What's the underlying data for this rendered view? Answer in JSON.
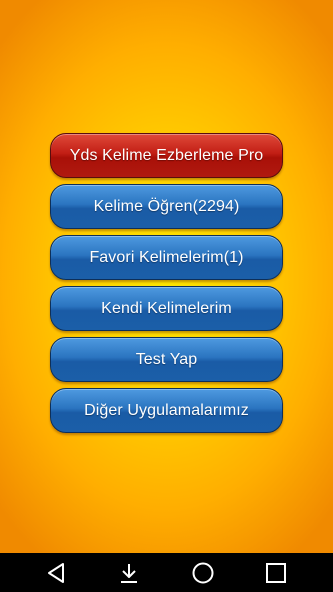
{
  "menu": {
    "items": [
      {
        "label": "Yds Kelime Ezberleme Pro",
        "style": "pro"
      },
      {
        "label": "Kelime Öğren(2294)",
        "style": "normal"
      },
      {
        "label": "Favori Kelimelerim(1)",
        "style": "normal"
      },
      {
        "label": "Kendi Kelimelerim",
        "style": "normal"
      },
      {
        "label": "Test Yap",
        "style": "normal"
      },
      {
        "label": "Diğer Uygulamalarımız",
        "style": "normal"
      }
    ]
  },
  "navbar": {
    "icons": [
      "back-icon",
      "download-icon",
      "home-icon",
      "recents-icon"
    ]
  },
  "colors": {
    "background_center": "#ffe600",
    "background_edge": "#f08a00",
    "button_blue": "#2a74c0",
    "button_red": "#c21e14",
    "navbar": "#000000"
  }
}
